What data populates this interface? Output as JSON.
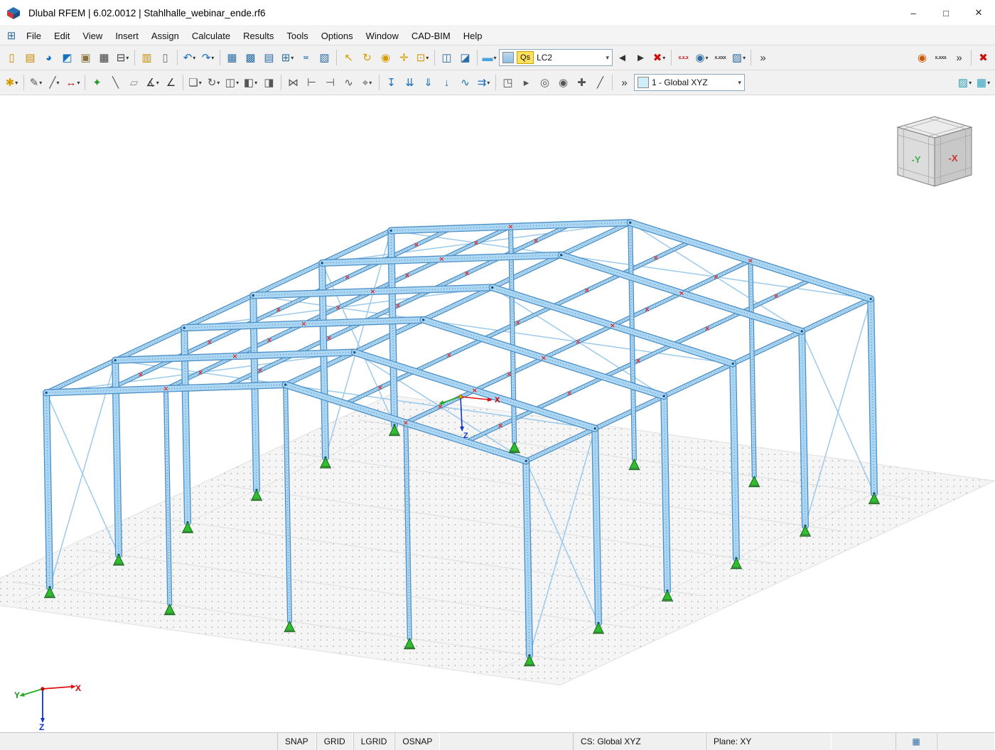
{
  "window": {
    "title": "Dlubal RFEM | 6.02.0012 | Stahlhalle_webinar_ende.rf6",
    "controls": {
      "minimize": "–",
      "maximize": "□",
      "close": "✕"
    }
  },
  "menu": {
    "icon_glyph": "⊞",
    "items": [
      "File",
      "Edit",
      "View",
      "Insert",
      "Assign",
      "Calculate",
      "Results",
      "Tools",
      "Options",
      "Window",
      "CAD-BIM",
      "Help"
    ]
  },
  "toolbar1": {
    "load_case": {
      "tag": "Qs",
      "value": "LC2"
    },
    "items": [
      {
        "n": "new-model",
        "g": "▯",
        "c": "#c98a00"
      },
      {
        "n": "open-model",
        "g": "▤",
        "c": "#c98a00"
      },
      {
        "n": "dlubal-center",
        "g": "◕",
        "c": "#1470c0"
      },
      {
        "n": "render-view",
        "g": "◩",
        "c": "#1470c0"
      },
      {
        "n": "clipboard",
        "g": "▣",
        "c": "#8a7040"
      },
      {
        "n": "save",
        "g": "▦",
        "c": "#3d3d3d"
      },
      {
        "n": "print",
        "g": "⊟",
        "c": "#3d3d3d",
        "d": 1
      },
      {
        "t": "sep"
      },
      {
        "n": "printout-report",
        "g": "▥",
        "c": "#c98a00"
      },
      {
        "n": "notes",
        "g": "▯",
        "c": "#707070"
      },
      {
        "t": "sep"
      },
      {
        "n": "undo",
        "g": "↶",
        "c": "#1470c0",
        "d": 1
      },
      {
        "n": "redo",
        "g": "↷",
        "c": "#1470c0",
        "d": 1
      },
      {
        "t": "sep"
      },
      {
        "n": "tables",
        "g": "▦",
        "c": "#2e6da4"
      },
      {
        "n": "table-grid",
        "g": "▩",
        "c": "#2e6da4"
      },
      {
        "n": "table-edit",
        "g": "▤",
        "c": "#2e6da4"
      },
      {
        "n": "table-goto",
        "g": "⊞",
        "c": "#2e6da4",
        "d": 1
      },
      {
        "n": "table-sc",
        "g": "sc",
        "c": "#2e6da4",
        "small": 1
      },
      {
        "n": "table-filter",
        "g": "▧",
        "c": "#2e6da4"
      },
      {
        "t": "sep"
      },
      {
        "n": "select-pointer",
        "g": "↖",
        "c": "#d79b00"
      },
      {
        "n": "rotate-view",
        "g": "↻",
        "c": "#d79b00"
      },
      {
        "n": "zoom-view",
        "g": "◉",
        "c": "#d79b00"
      },
      {
        "n": "pan-view",
        "g": "✛",
        "c": "#d79b00"
      },
      {
        "n": "zoom-window",
        "g": "⊡",
        "c": "#d79b00",
        "d": 1
      },
      {
        "t": "sep"
      },
      {
        "n": "work-plane",
        "g": "◫",
        "c": "#2e6da4"
      },
      {
        "n": "snap-plane",
        "g": "◪",
        "c": "#2e6da4"
      },
      {
        "t": "sep"
      },
      {
        "n": "color-scale",
        "g": "▬",
        "c": "#4aa3df",
        "d": 1
      },
      {
        "t": "lc"
      },
      {
        "n": "previous-load-case",
        "g": "◄",
        "c": "#333333"
      },
      {
        "n": "next-load-case",
        "g": "►",
        "c": "#333333"
      },
      {
        "n": "delete-loads",
        "g": "✖",
        "c": "#cc1111",
        "d": 1
      },
      {
        "t": "sep"
      },
      {
        "n": "show-load-values",
        "g": "x.x.x",
        "c": "#cc1111",
        "small": 1
      },
      {
        "n": "show-results",
        "g": "◉",
        "c": "#2e6da4",
        "d": 1
      },
      {
        "n": "show-result-values",
        "g": "x.xxx",
        "c": "#333333",
        "small": 1
      },
      {
        "n": "result-panel",
        "g": "▨",
        "c": "#2e6da4",
        "d": 1
      },
      {
        "t": "sep"
      },
      {
        "n": "more-commands",
        "g": "»",
        "c": "#333333"
      },
      {
        "t": "spacer"
      },
      {
        "n": "pick-object",
        "g": "◉",
        "c": "#cc5500"
      },
      {
        "n": "display-values",
        "g": "x.xxx",
        "c": "#333333",
        "small": 1
      },
      {
        "n": "overflow",
        "g": "»",
        "c": "#333333"
      },
      {
        "t": "sep"
      },
      {
        "n": "cancel",
        "g": "✖",
        "c": "#cc1111"
      }
    ]
  },
  "toolbar2": {
    "coordinate_system": "1 - Global XYZ",
    "items": [
      {
        "n": "snap-options",
        "g": "✱",
        "c": "#d79b00",
        "d": 1
      },
      {
        "t": "sep"
      },
      {
        "n": "edit-line",
        "g": "✎",
        "c": "#555555",
        "d": 1
      },
      {
        "n": "edit-polyline",
        "g": "╱",
        "c": "#555555",
        "d": 1
      },
      {
        "n": "dimensions",
        "g": "↔",
        "c": "#cc1111",
        "d": 1
      },
      {
        "t": "sep"
      },
      {
        "n": "new-node",
        "g": "✦",
        "c": "#2a9a2a"
      },
      {
        "n": "new-member",
        "g": "╲",
        "c": "#555555"
      },
      {
        "n": "new-surface",
        "g": "▱",
        "c": "#8a8a8a"
      },
      {
        "n": "dimension-x",
        "g": "∡",
        "c": "#333333",
        "d": 1
      },
      {
        "n": "dimension-xx",
        "g": "∠",
        "c": "#333333"
      },
      {
        "t": "sep"
      },
      {
        "n": "move-copy",
        "g": "❏",
        "c": "#555555",
        "d": 1
      },
      {
        "n": "rotate-copy",
        "g": "↻",
        "c": "#555555",
        "d": 1
      },
      {
        "n": "mirror",
        "g": "◫",
        "c": "#555555",
        "d": 1
      },
      {
        "n": "extrude-member",
        "g": "◧",
        "c": "#555555",
        "d": 1
      },
      {
        "n": "extrude-surface",
        "g": "◨",
        "c": "#555555"
      },
      {
        "t": "sep"
      },
      {
        "n": "connect-members",
        "g": "⋈",
        "c": "#555555"
      },
      {
        "n": "divide-member",
        "g": "⊢",
        "c": "#555555"
      },
      {
        "n": "trim-members",
        "g": "⊣",
        "c": "#555555"
      },
      {
        "n": "smooth-line",
        "g": "∿",
        "c": "#555555"
      },
      {
        "n": "snap-node",
        "g": "⌖",
        "c": "#555555",
        "d": 1
      },
      {
        "t": "sep"
      },
      {
        "n": "nodal-load",
        "g": "↧",
        "c": "#1470c0"
      },
      {
        "n": "member-load",
        "g": "⇊",
        "c": "#1470c0"
      },
      {
        "n": "surface-load",
        "g": "⇓",
        "c": "#1470c0"
      },
      {
        "n": "free-load",
        "g": "↓",
        "c": "#1470c0"
      },
      {
        "n": "imperfection",
        "g": "∿",
        "c": "#1470c0"
      },
      {
        "n": "load-generator",
        "g": "⇉",
        "c": "#1470c0",
        "d": 1
      },
      {
        "t": "sep"
      },
      {
        "n": "visibility-clip",
        "g": "◳",
        "c": "#555555"
      },
      {
        "n": "animation",
        "g": "▸",
        "c": "#555555"
      },
      {
        "n": "render-mode",
        "g": "◎",
        "c": "#555555"
      },
      {
        "n": "camera-view",
        "g": "◉",
        "c": "#555555"
      },
      {
        "n": "walk-mode",
        "g": "✚",
        "c": "#555555"
      },
      {
        "n": "section-plane",
        "g": "╱",
        "c": "#555555"
      },
      {
        "t": "sep"
      },
      {
        "n": "more-tools",
        "g": "»",
        "c": "#333333"
      },
      {
        "t": "cs"
      },
      {
        "t": "spacer"
      },
      {
        "n": "visibility-filter",
        "g": "▨",
        "c": "#2aa0c0",
        "d": 1
      },
      {
        "n": "display-style",
        "g": "▦",
        "c": "#2aa0c0",
        "d": 1
      }
    ]
  },
  "statusbar": {
    "toggles": [
      "SNAP",
      "GRID",
      "LGRID",
      "OSNAP"
    ],
    "cs_label": "CS: Global XYZ",
    "plane_label": "Plane: XY",
    "table_icon": "▦"
  },
  "viewport": {
    "background": "#ffffff",
    "colors": {
      "member_edge": "#4f8fc4",
      "member_fill": "#a9d7f5",
      "brace": "#9ccaec",
      "ground": "#f5f5f5",
      "support": "#2fbe2f",
      "support_dark": "#156815",
      "marker": "#dd2222",
      "node": "#17507e"
    },
    "navcube": {
      "front_label": "-Y",
      "right_label": "-X"
    },
    "axes": {
      "x": "X",
      "y": "Y",
      "z": "Z"
    },
    "projection": {
      "origin": [
        70,
        692
      ],
      "ux": [
        33.75,
        4.8
      ],
      "uy": [
        19.4,
        -9.12
      ],
      "uz": [
        -0.8,
        -45.6
      ]
    },
    "model": {
      "span": 20,
      "bays": 5,
      "bay_len": 5,
      "col_h": 6,
      "apex_h": 7.3,
      "purlins": [
        2.5,
        5,
        7.5,
        12.5,
        15,
        17.5
      ],
      "gable_cols": [
        5,
        10,
        15
      ],
      "wall_brace_bays": [
        0,
        4
      ],
      "roof_brace_bays": [
        0,
        2,
        4
      ]
    }
  }
}
